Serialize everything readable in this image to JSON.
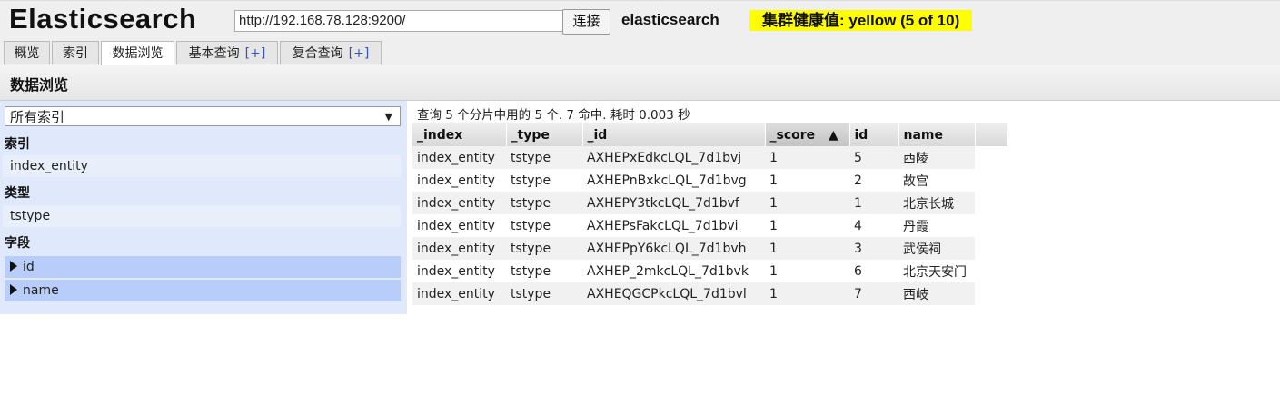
{
  "header": {
    "app_title": "Elasticsearch",
    "url_value": "http://192.168.78.128:9200/",
    "connect_label": "连接",
    "cluster_name": "elasticsearch",
    "health_text": "集群健康值: yellow (5 of 10)",
    "health_color": "#ffff00"
  },
  "tabs": [
    {
      "label": "概览"
    },
    {
      "label": "索引"
    },
    {
      "label": "数据浏览",
      "active": true
    },
    {
      "label": "基本查询",
      "extra": "[+]"
    },
    {
      "label": "复合查询",
      "extra": "[+]"
    }
  ],
  "section_title": "数据浏览",
  "sidebar": {
    "index_select": "所有索引",
    "index_heading": "索引",
    "indices": [
      "index_entity"
    ],
    "type_heading": "类型",
    "types": [
      "tstype"
    ],
    "field_heading": "字段",
    "fields": [
      "id",
      "name"
    ]
  },
  "results": {
    "summary": "查询 5 个分片中用的 5 个. 7 命中. 耗时 0.003 秒",
    "columns": [
      "_index",
      "_type",
      "_id",
      "_score",
      "id",
      "name"
    ],
    "sort_indicator": "▲",
    "rows": [
      [
        "index_entity",
        "tstype",
        "AXHEPxEdkcLQL_7d1bvj",
        "1",
        "5",
        "西陵"
      ],
      [
        "index_entity",
        "tstype",
        "AXHEPnBxkcLQL_7d1bvg",
        "1",
        "2",
        "故宫"
      ],
      [
        "index_entity",
        "tstype",
        "AXHEPY3tkcLQL_7d1bvf",
        "1",
        "1",
        "北京长城"
      ],
      [
        "index_entity",
        "tstype",
        "AXHEPsFakcLQL_7d1bvi",
        "1",
        "4",
        "丹霞"
      ],
      [
        "index_entity",
        "tstype",
        "AXHEPpY6kcLQL_7d1bvh",
        "1",
        "3",
        "武侯祠"
      ],
      [
        "index_entity",
        "tstype",
        "AXHEP_2mkcLQL_7d1bvk",
        "1",
        "6",
        "北京天安门"
      ],
      [
        "index_entity",
        "tstype",
        "AXHEQGCPkcLQL_7d1bvl",
        "1",
        "7",
        "西岐"
      ]
    ]
  }
}
